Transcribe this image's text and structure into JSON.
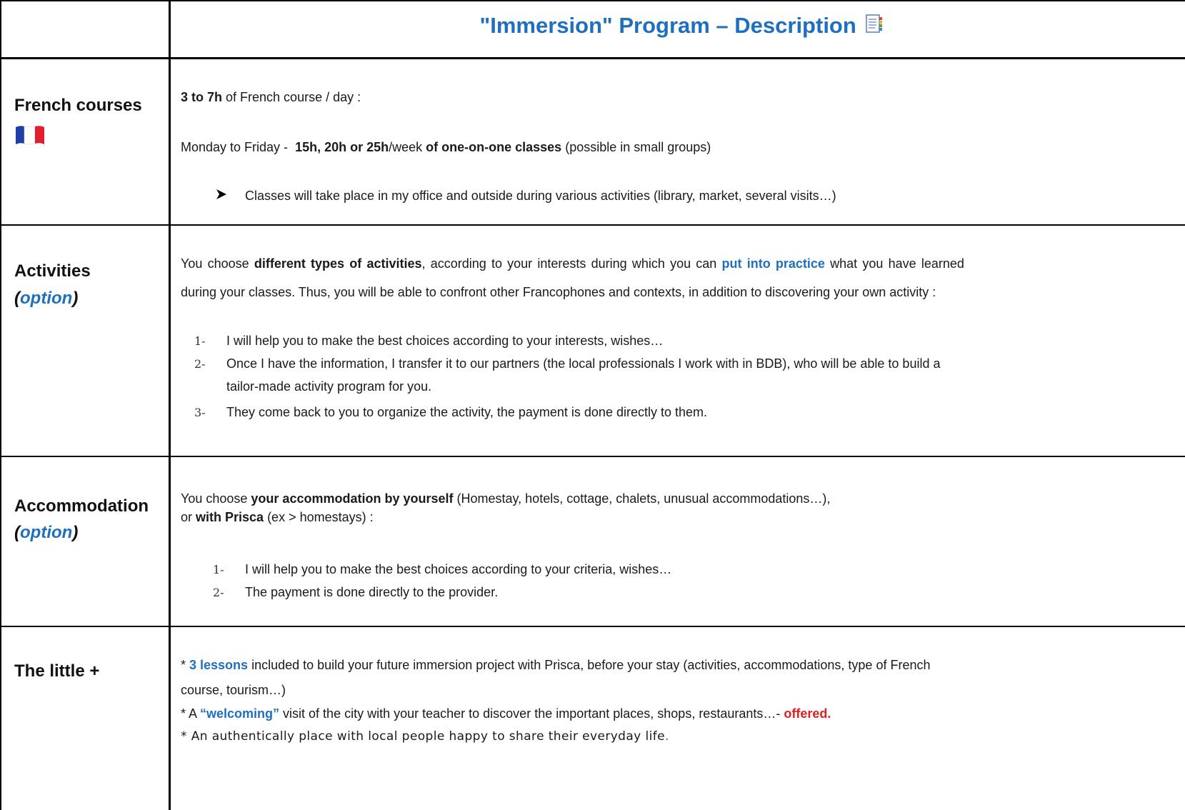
{
  "title": "\"Immersion\" Program – Description",
  "rows": {
    "french": {
      "label": "French courses",
      "line1_bold": "3 to 7h",
      "line1_rest": " of French course / day :",
      "line2_a": "Monday to Friday -  ",
      "line2_bold1": "15h, 20h or 25h",
      "line2_b": "/week ",
      "line2_bold2": "of one-on-one classes",
      "line2_c": " (possible in small groups)",
      "bullet": "Classes will take place in my office and outside during various activities (library, market, several visits…)"
    },
    "activities": {
      "label": "Activities",
      "option_open": "(",
      "option_word": "option",
      "option_close": ")",
      "p1_a": "You choose ",
      "p1_bold": "different types of activities",
      "p1_b": ", according to your interests during which you can ",
      "p1_blue": "put into practice",
      "p1_c": " what you have learned",
      "p2": "during your classes. Thus, you will be able to confront other Francophones and contexts, in addition to discovering your own activity :",
      "items": [
        {
          "num": "1-",
          "text": "I will help you to make the best choices according to your interests, wishes…"
        },
        {
          "num": "2-",
          "text": "Once I have the information, I transfer it to our partners (the local professionals I work with in BDB), who will be able to build a"
        },
        {
          "num": "",
          "text": "tailor-made activity program for you."
        },
        {
          "num": "3-",
          "text": "They come back to you to organize the activity, the payment is done directly to them."
        }
      ]
    },
    "accommodation": {
      "label": "Accommodation",
      "option_open": "(",
      "option_word": "option",
      "option_close": ")",
      "p1_a": "You choose ",
      "p1_bold": "your accommodation by yourself",
      "p1_b": " (Homestay, hotels, cottage, chalets, unusual accommodations…),",
      "p2_a": "or ",
      "p2_bold": "with Prisca",
      "p2_b": " (ex > homestays) :",
      "items": [
        {
          "num": "1-",
          "text": "I will help you to make the best choices according to your criteria, wishes…"
        },
        {
          "num": "2-",
          "text": "The payment is done directly to the provider."
        }
      ]
    },
    "little": {
      "label": "The little +",
      "l1_star": "* ",
      "l1_blue": "3 lessons",
      "l1_rest": " included to build your future immersion project with Prisca, before your stay (activities, accommodations, type of French",
      "l2": "course, tourism…)",
      "l3_a": "* A ",
      "l3_blue": "“welcoming”",
      "l3_b": " visit of the city with your teacher to discover the important places, shops, restaurants…- ",
      "l3_red": "offered.",
      "l4": "* An authentically place with local people happy to share their everyday life",
      "l4_dot": "."
    }
  },
  "colors": {
    "accent_blue": "#1f6fbf",
    "accent_red": "#e02020",
    "border": "#000000"
  },
  "icons": {
    "title_icon": "document-list-icon",
    "flag": "french-flag-icon",
    "bullet": "arrow-bullet-icon"
  }
}
